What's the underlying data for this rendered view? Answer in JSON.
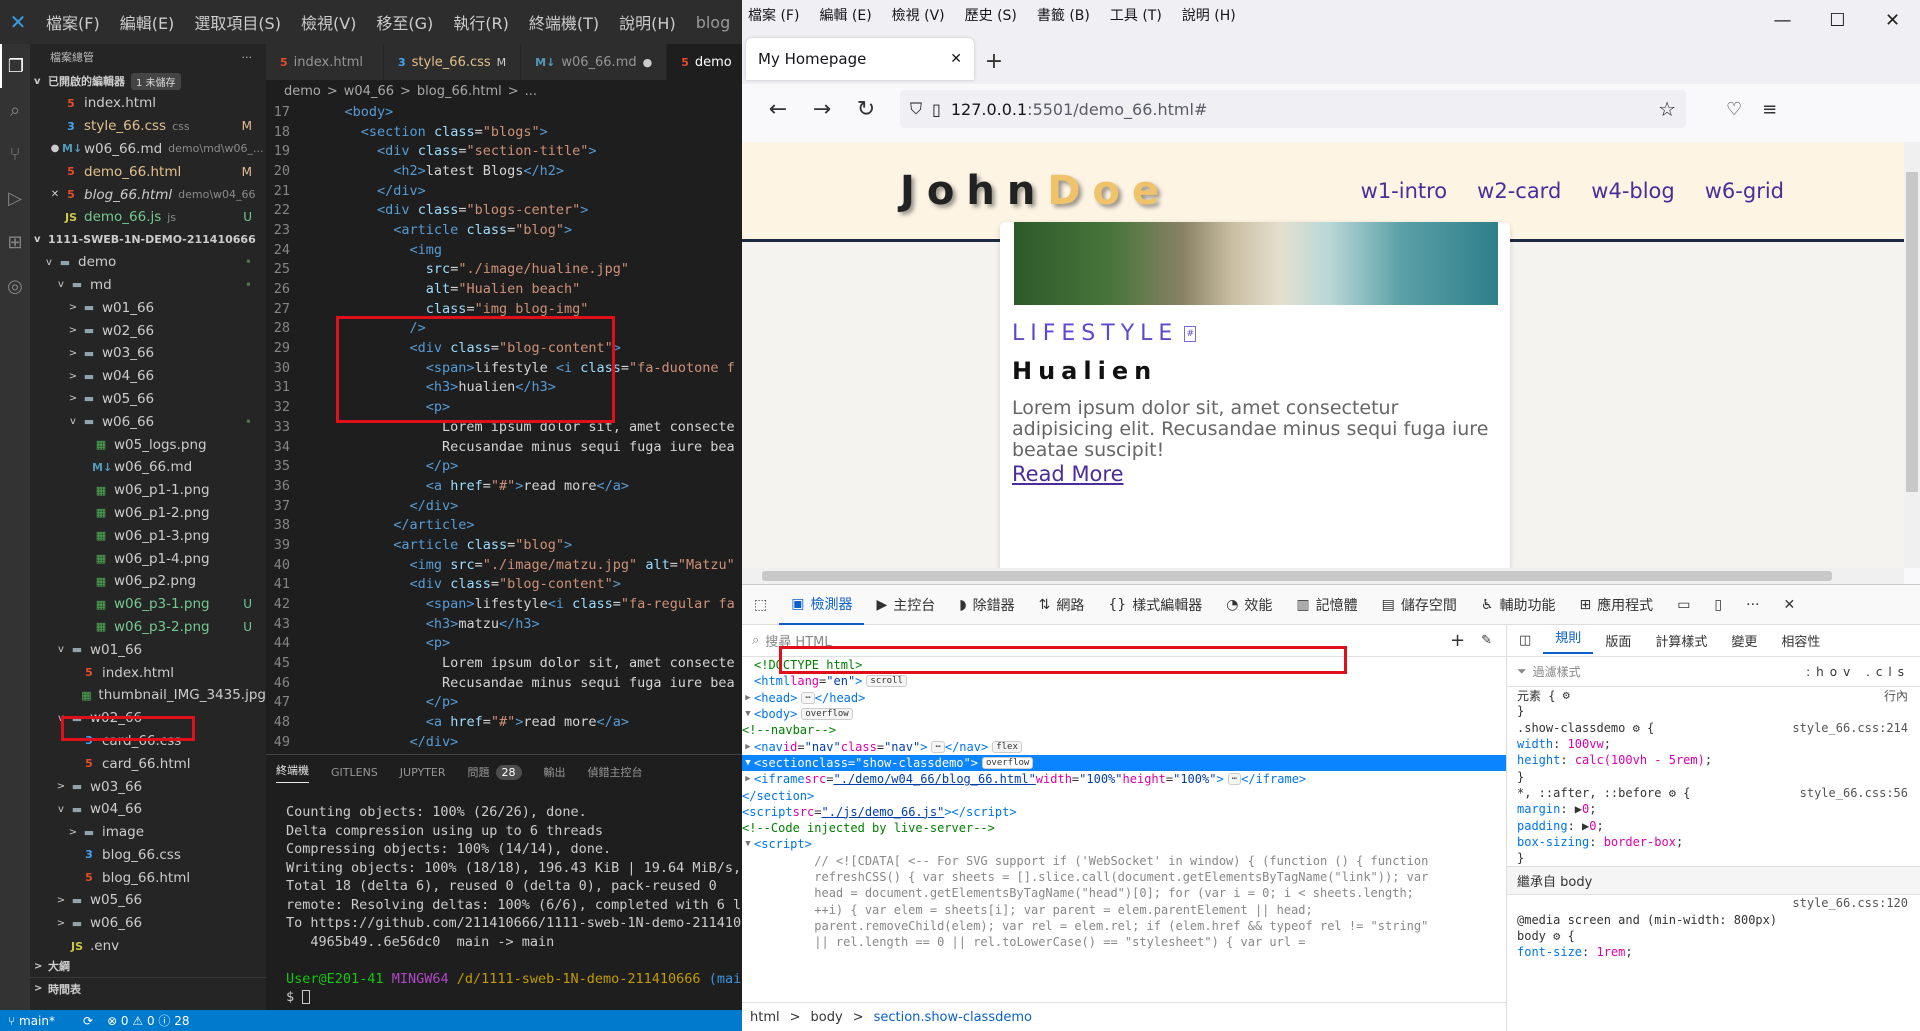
{
  "vscode": {
    "menu": [
      "檔案(F)",
      "編輯(E)",
      "選取項目(S)",
      "檢視(V)",
      "移至(G)",
      "執行(R)",
      "終端機(T)",
      "說明(H)"
    ],
    "menu_trailing": "blog",
    "explorer_title": "檔案總管",
    "open_editors_title": "已開啟的編輯器",
    "open_editors_badge": "1 未儲存",
    "open_editors": [
      {
        "name": "index.html",
        "type": "html",
        "sub": "",
        "status": ""
      },
      {
        "name": "style_66.css",
        "type": "css",
        "sub": "css",
        "status": "M"
      },
      {
        "name": "w06_66.md",
        "type": "md",
        "sub": "demo\\md\\w06_...",
        "status": ""
      },
      {
        "name": "demo_66.html",
        "type": "html",
        "sub": "",
        "status": "M"
      },
      {
        "name": "blog_66.html",
        "type": "html",
        "sub": "demo\\w04_66",
        "status": ""
      },
      {
        "name": "demo_66.js",
        "type": "js",
        "sub": "js",
        "status": "U"
      }
    ],
    "workspace_title": "1111-SWEB-1N-DEMO-211410666",
    "tree": [
      {
        "indent": 1,
        "arrow": "v",
        "icon": "fold",
        "name": "demo",
        "status": "•"
      },
      {
        "indent": 2,
        "arrow": "v",
        "icon": "fold",
        "name": "md",
        "status": "•"
      },
      {
        "indent": 3,
        "arrow": ">",
        "icon": "fold",
        "name": "w01_66",
        "status": ""
      },
      {
        "indent": 3,
        "arrow": ">",
        "icon": "fold",
        "name": "w02_66",
        "status": ""
      },
      {
        "indent": 3,
        "arrow": ">",
        "icon": "fold",
        "name": "w03_66",
        "status": ""
      },
      {
        "indent": 3,
        "arrow": ">",
        "icon": "fold",
        "name": "w04_66",
        "status": ""
      },
      {
        "indent": 3,
        "arrow": ">",
        "icon": "fold",
        "name": "w05_66",
        "status": ""
      },
      {
        "indent": 3,
        "arrow": "v",
        "icon": "fold",
        "name": "w06_66",
        "status": "•"
      },
      {
        "indent": 4,
        "arrow": "",
        "icon": "png",
        "name": "w05_logs.png",
        "status": ""
      },
      {
        "indent": 4,
        "arrow": "",
        "icon": "md",
        "name": "w06_66.md",
        "status": ""
      },
      {
        "indent": 4,
        "arrow": "",
        "icon": "png",
        "name": "w06_p1-1.png",
        "status": ""
      },
      {
        "indent": 4,
        "arrow": "",
        "icon": "png",
        "name": "w06_p1-2.png",
        "status": ""
      },
      {
        "indent": 4,
        "arrow": "",
        "icon": "png",
        "name": "w06_p1-3.png",
        "status": ""
      },
      {
        "indent": 4,
        "arrow": "",
        "icon": "png",
        "name": "w06_p1-4.png",
        "status": ""
      },
      {
        "indent": 4,
        "arrow": "",
        "icon": "png",
        "name": "w06_p2.png",
        "status": ""
      },
      {
        "indent": 4,
        "arrow": "",
        "icon": "png",
        "name": "w06_p3-1.png",
        "status": "U"
      },
      {
        "indent": 4,
        "arrow": "",
        "icon": "png",
        "name": "w06_p3-2.png",
        "status": "U"
      },
      {
        "indent": 2,
        "arrow": "v",
        "icon": "fold",
        "name": "w01_66",
        "status": ""
      },
      {
        "indent": 3,
        "arrow": "",
        "icon": "html",
        "name": "index.html",
        "status": ""
      },
      {
        "indent": 3,
        "arrow": "",
        "icon": "png",
        "name": "thumbnail_IMG_3435.jpg",
        "status": ""
      },
      {
        "indent": 2,
        "arrow": "v",
        "icon": "fold",
        "name": "w02_66",
        "status": ""
      },
      {
        "indent": 3,
        "arrow": "",
        "icon": "css",
        "name": "card_66.css",
        "status": ""
      },
      {
        "indent": 3,
        "arrow": "",
        "icon": "html",
        "name": "card_66.html",
        "status": ""
      },
      {
        "indent": 2,
        "arrow": ">",
        "icon": "fold",
        "name": "w03_66",
        "status": ""
      },
      {
        "indent": 2,
        "arrow": "v",
        "icon": "fold",
        "name": "w04_66",
        "status": ""
      },
      {
        "indent": 3,
        "arrow": ">",
        "icon": "fold",
        "name": "image",
        "status": ""
      },
      {
        "indent": 3,
        "arrow": "",
        "icon": "css",
        "name": "blog_66.css",
        "status": ""
      },
      {
        "indent": 3,
        "arrow": "",
        "icon": "html",
        "name": "blog_66.html",
        "status": ""
      },
      {
        "indent": 2,
        "arrow": ">",
        "icon": "fold",
        "name": "w05_66",
        "status": ""
      },
      {
        "indent": 2,
        "arrow": ">",
        "icon": "fold",
        "name": "w06_66",
        "status": ""
      },
      {
        "indent": 2,
        "arrow": "",
        "icon": "js",
        "name": ".env",
        "status": ""
      }
    ],
    "outline_title": "大綱",
    "timeline_title": "時間表",
    "tabs": [
      {
        "name": "index.html",
        "icon": "html",
        "mark": "",
        "active": false
      },
      {
        "name": "style_66.css",
        "icon": "css",
        "mark": "M",
        "active": false
      },
      {
        "name": "w06_66.md",
        "icon": "md",
        "mark": "●",
        "active": false
      },
      {
        "name": "demo",
        "icon": "html",
        "mark": "",
        "active": true
      }
    ],
    "breadcrumbs": [
      "demo",
      ">",
      "w04_66",
      ">",
      "blog_66.html",
      ">",
      "..."
    ],
    "code_lines": [
      {
        "n": "17",
        "html": "    <span class='tg'>&lt;body&gt;</span>"
      },
      {
        "n": "18",
        "html": "      <span class='tg'>&lt;section</span> <span class='at'>class</span>=<span class='sv'>\"blogs\"</span><span class='tg'>&gt;</span>"
      },
      {
        "n": "19",
        "html": "        <span class='tg'>&lt;div</span> <span class='at'>class</span>=<span class='sv'>\"section-title\"</span><span class='tg'>&gt;</span>"
      },
      {
        "n": "20",
        "html": "          <span class='tg'>&lt;h2&gt;</span>latest Blogs<span class='tg'>&lt;/h2&gt;</span>"
      },
      {
        "n": "21",
        "html": "        <span class='tg'>&lt;/div&gt;</span>"
      },
      {
        "n": "22",
        "html": "        <span class='tg'>&lt;div</span> <span class='at'>class</span>=<span class='sv'>\"blogs-center\"</span><span class='tg'>&gt;</span>"
      },
      {
        "n": "23",
        "html": "          <span class='tg'>&lt;article</span> <span class='at'>class</span>=<span class='sv'>\"blog\"</span><span class='tg'>&gt;</span>"
      },
      {
        "n": "24",
        "html": "            <span class='tg'>&lt;img</span>"
      },
      {
        "n": "25",
        "html": "              <span class='at'>src</span>=<span class='sv'>\"./image/hualine.jpg\"</span>"
      },
      {
        "n": "26",
        "html": "              <span class='at'>alt</span>=<span class='sv'>\"Hualien beach\"</span>"
      },
      {
        "n": "27",
        "html": "              <span class='at'>class</span>=<span class='sv'>\"img blog-img\"</span>"
      },
      {
        "n": "28",
        "html": "            <span class='tg'>/&gt;</span>"
      },
      {
        "n": "29",
        "html": "            <span class='tg'>&lt;div</span> <span class='at'>class</span>=<span class='sv'>\"blog-content\"</span><span class='tg'>&gt;</span>"
      },
      {
        "n": "30",
        "html": "              <span class='tg'>&lt;span&gt;</span>lifestyle <span class='tg'>&lt;i</span> <span class='at'>class</span>=<span class='sv'>\"fa-duotone f</span>"
      },
      {
        "n": "31",
        "html": "              <span class='tg'>&lt;h3&gt;</span>hualien<span class='tg'>&lt;/h3&gt;</span>"
      },
      {
        "n": "32",
        "html": "              <span class='tg'>&lt;p&gt;</span>"
      },
      {
        "n": "33",
        "html": "                Lorem ipsum dolor sit, amet consecte"
      },
      {
        "n": "34",
        "html": "                Recusandae minus sequi fuga iure bea"
      },
      {
        "n": "35",
        "html": "              <span class='tg'>&lt;/p&gt;</span>"
      },
      {
        "n": "36",
        "html": "              <span class='tg'>&lt;a</span> <span class='at'>href</span>=<span class='sv'>\"#\"</span><span class='tg'>&gt;</span>read more<span class='tg'>&lt;/a&gt;</span>"
      },
      {
        "n": "37",
        "html": "            <span class='tg'>&lt;/div&gt;</span>"
      },
      {
        "n": "38",
        "html": "          <span class='tg'>&lt;/article&gt;</span>"
      },
      {
        "n": "39",
        "html": "          <span class='tg'>&lt;article</span> <span class='at'>class</span>=<span class='sv'>\"blog\"</span><span class='tg'>&gt;</span>"
      },
      {
        "n": "40",
        "html": "            <span class='tg'>&lt;img</span> <span class='at'>src</span>=<span class='sv'>\"./image/matzu.jpg\"</span> <span class='at'>alt</span>=<span class='sv'>\"Matzu\"</span>"
      },
      {
        "n": "41",
        "html": "            <span class='tg'>&lt;div</span> <span class='at'>class</span>=<span class='sv'>\"blog-content\"</span><span class='tg'>&gt;</span>"
      },
      {
        "n": "42",
        "html": "              <span class='tg'>&lt;span&gt;</span>lifestyle<span class='tg'>&lt;i</span> <span class='at'>class</span>=<span class='sv'>\"fa-regular fa</span>"
      },
      {
        "n": "43",
        "html": "              <span class='tg'>&lt;h3&gt;</span>matzu<span class='tg'>&lt;/h3&gt;</span>"
      },
      {
        "n": "44",
        "html": "              <span class='tg'>&lt;p&gt;</span>"
      },
      {
        "n": "45",
        "html": "                Lorem ipsum dolor sit, amet consecte"
      },
      {
        "n": "46",
        "html": "                Recusandae minus sequi fuga iure bea"
      },
      {
        "n": "47",
        "html": "              <span class='tg'>&lt;/p&gt;</span>"
      },
      {
        "n": "48",
        "html": "              <span class='tg'>&lt;a</span> <span class='at'>href</span>=<span class='sv'>\"#\"</span><span class='tg'>&gt;</span>read more<span class='tg'>&lt;/a&gt;</span>"
      },
      {
        "n": "49",
        "html": "            <span class='tg'>&lt;/div&gt;</span>"
      }
    ],
    "panel_tabs": [
      "終端機",
      "GITLENS",
      "JUPYTER",
      "問題",
      "28",
      "輸出",
      "偵錯主控台"
    ],
    "terminal_lines": [
      "Counting objects: 100% (26/26), done.",
      "Delta compression using up to 6 threads",
      "Compressing objects: 100% (14/14), done.",
      "Writing objects: 100% (18/18), 196.43 KiB | 19.64 MiB/s,",
      "Total 18 (delta 6), reused 0 (delta 0), pack-reused 0",
      "remote: Resolving deltas: 100% (6/6), completed with 6 lo",
      "To https://github.com/211410666/1111-sweb-1N-demo-2114106",
      "   4965b49..6e56dc0  main -> main",
      ""
    ],
    "prompt_user": "User@E201-41",
    "prompt_shell": "MINGW64",
    "prompt_path": "/d/1111-sweb-1N-demo-211410666",
    "prompt_branch": "(main",
    "prompt_symbol": "$",
    "status": {
      "branch": "main*",
      "errors": "⊗ 0 ⚠ 0 ⓘ 28"
    }
  },
  "firefox": {
    "menu": [
      "檔案 (F)",
      "編輯 (E)",
      "檢視 (V)",
      "歷史 (S)",
      "書籤 (B)",
      "工具 (T)",
      "說明 (H)"
    ],
    "tab_title": "My Homepage",
    "url_host": "127.0.0.1",
    "url_rest": ":5501/demo_66.html#",
    "site": {
      "logo_first": "John",
      "logo_last": "Doe",
      "nav_links": [
        "w1-intro",
        "w2-card",
        "w4-blog",
        "w6-grid"
      ],
      "category": "LIFESTYLE",
      "title": "Hualien",
      "paragraph": "Lorem ipsum dolor sit, amet consectetur adipisicing elit. Recusandae minus sequi fuga iure beatae suscipit!",
      "read_more": "Read More"
    },
    "devtools": {
      "tools": [
        "檢測器",
        "主控台",
        "除錯器",
        "網路",
        "樣式編輯器",
        "效能",
        "記憶體",
        "儲存空間",
        "輔助功能",
        "應用程式"
      ],
      "search_placeholder": "搜尋 HTML",
      "breadcrumbs": [
        "html",
        ">",
        "body",
        ">",
        "section.show-classdemo"
      ],
      "rule_tabs": [
        "規則",
        "版面",
        "計算樣式",
        "變更",
        "相容性"
      ],
      "filter_placeholder": "過濾樣式",
      "filter_tools": ":hov .cls",
      "element_label": "元素 {",
      "inline_label": "行內",
      "inherited_label": "繼承自 body"
    }
  }
}
